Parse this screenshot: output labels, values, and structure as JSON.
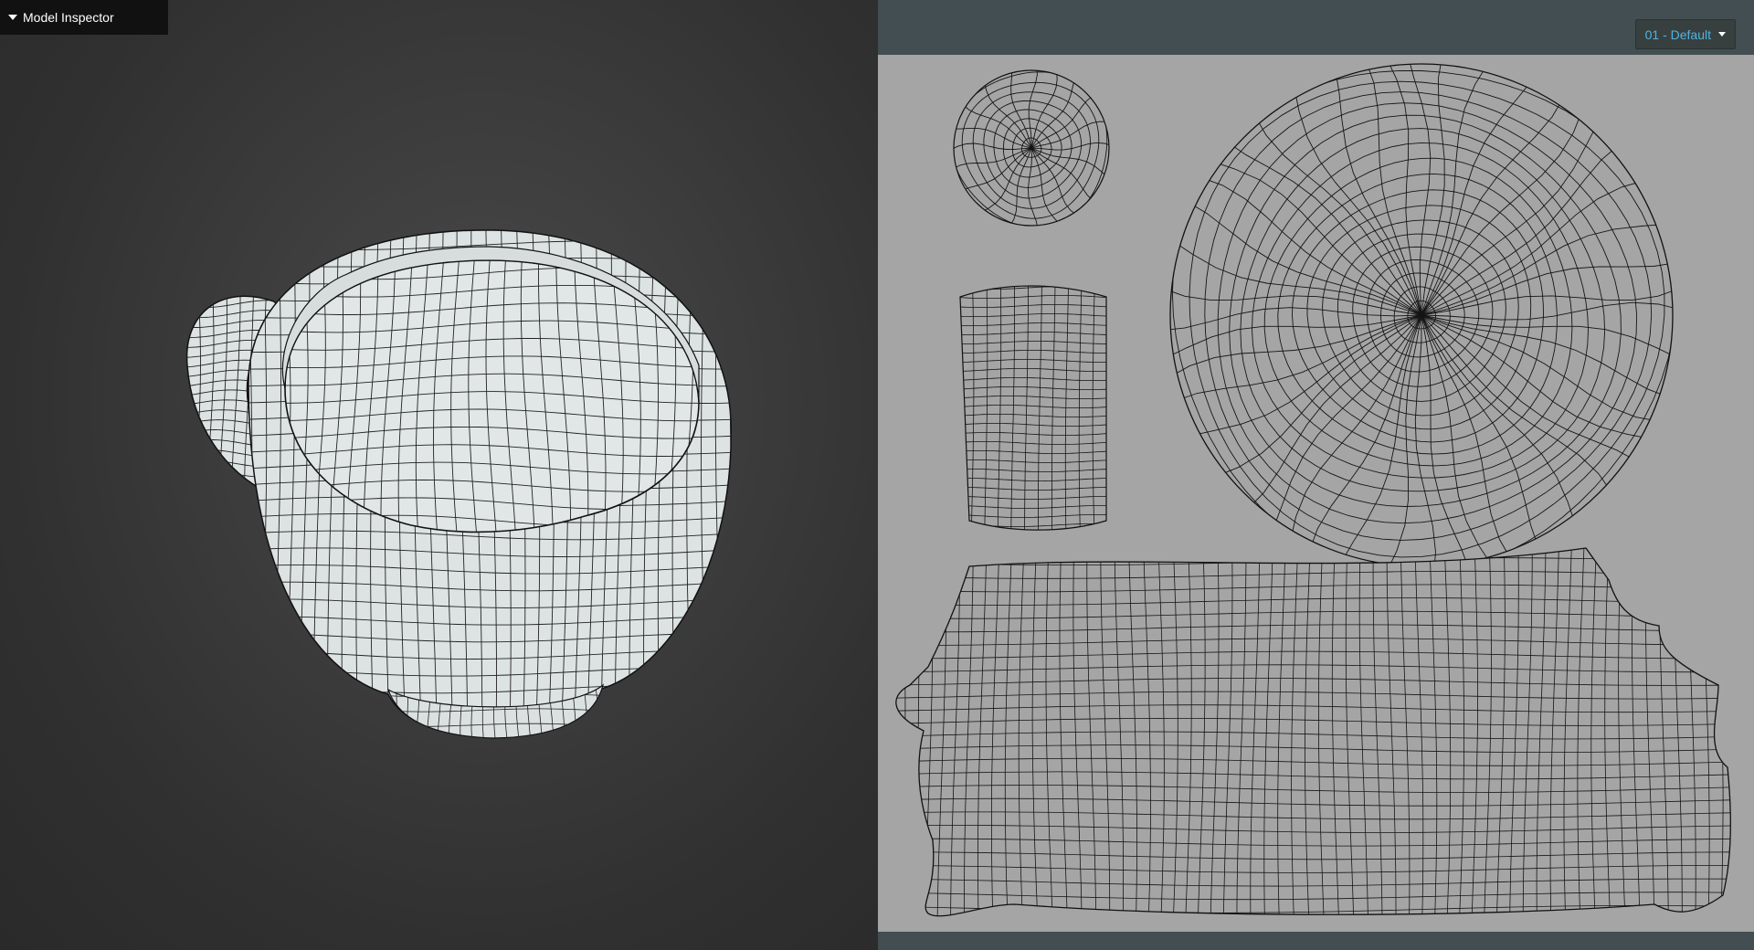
{
  "inspector": {
    "title": "Model Inspector",
    "toggle_icon": "caret-down-icon"
  },
  "viewport": {
    "model": "mug-wireframe",
    "background_color": "#3a3a3a",
    "mesh_fill": "#dde3e3",
    "wire_color": "#111111"
  },
  "uv_editor": {
    "material_select": {
      "value": "01 - Default",
      "icon": "chevron-down-icon"
    },
    "canvas_color": "#a5a5a5",
    "panel_color": "#424e51",
    "islands": [
      "small-disc",
      "handle-strip",
      "large-disc",
      "body-strip"
    ]
  }
}
